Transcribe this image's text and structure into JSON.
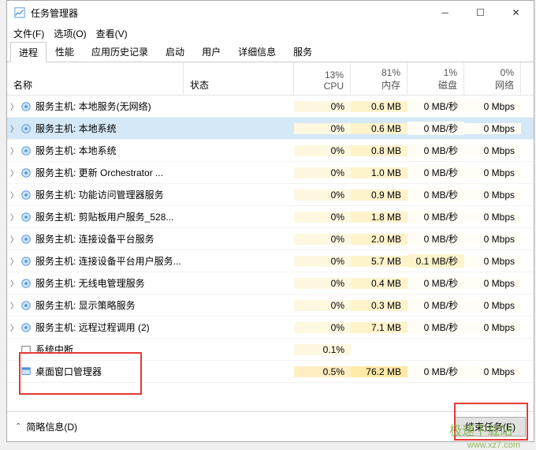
{
  "titlebar": {
    "title": "任务管理器"
  },
  "menu": {
    "file": "文件(F)",
    "options": "选项(O)",
    "view": "查看(V)"
  },
  "tabs": [
    "进程",
    "性能",
    "应用历史记录",
    "启动",
    "用户",
    "详细信息",
    "服务"
  ],
  "columns": {
    "name": "名称",
    "status": "状态",
    "cpu": {
      "pct": "13%",
      "label": "CPU"
    },
    "mem": {
      "pct": "81%",
      "label": "内存"
    },
    "disk": {
      "pct": "1%",
      "label": "磁盘"
    },
    "net": {
      "pct": "0%",
      "label": "网络"
    }
  },
  "rows": [
    {
      "expand": true,
      "icon": "gear",
      "name": "服务主机: 本地服务(无网络)",
      "cpu": "0%",
      "mem": "0.6 MB",
      "disk": "0 MB/秒",
      "net": "0 Mbps",
      "selected": false
    },
    {
      "expand": true,
      "icon": "gear",
      "name": "服务主机: 本地系统",
      "cpu": "0%",
      "mem": "0.6 MB",
      "disk": "0 MB/秒",
      "net": "0 Mbps",
      "selected": true
    },
    {
      "expand": true,
      "icon": "gear",
      "name": "服务主机: 本地系统",
      "cpu": "0%",
      "mem": "0.8 MB",
      "disk": "0 MB/秒",
      "net": "0 Mbps",
      "selected": false
    },
    {
      "expand": true,
      "icon": "gear",
      "name": "服务主机: 更新 Orchestrator ...",
      "cpu": "0%",
      "mem": "1.0 MB",
      "disk": "0 MB/秒",
      "net": "0 Mbps",
      "selected": false
    },
    {
      "expand": true,
      "icon": "gear",
      "name": "服务主机: 功能访问管理器服务",
      "cpu": "0%",
      "mem": "0.9 MB",
      "disk": "0 MB/秒",
      "net": "0 Mbps",
      "selected": false
    },
    {
      "expand": true,
      "icon": "gear",
      "name": "服务主机: 剪贴板用户服务_528...",
      "cpu": "0%",
      "mem": "1.8 MB",
      "disk": "0 MB/秒",
      "net": "0 Mbps",
      "selected": false
    },
    {
      "expand": true,
      "icon": "gear",
      "name": "服务主机: 连接设备平台服务",
      "cpu": "0%",
      "mem": "2.0 MB",
      "disk": "0 MB/秒",
      "net": "0 Mbps",
      "selected": false
    },
    {
      "expand": true,
      "icon": "gear",
      "name": "服务主机: 连接设备平台用户服务...",
      "cpu": "0%",
      "mem": "5.7 MB",
      "disk": "0.1 MB/秒",
      "diskhot": true,
      "net": "0 Mbps",
      "selected": false
    },
    {
      "expand": true,
      "icon": "gear",
      "name": "服务主机: 无线电管理服务",
      "cpu": "0%",
      "mem": "0.4 MB",
      "disk": "0 MB/秒",
      "net": "0 Mbps",
      "selected": false
    },
    {
      "expand": true,
      "icon": "gear",
      "name": "服务主机: 显示策略服务",
      "cpu": "0%",
      "mem": "0.3 MB",
      "disk": "0 MB/秒",
      "net": "0 Mbps",
      "selected": false
    },
    {
      "expand": true,
      "icon": "gear",
      "name": "服务主机: 远程过程调用 (2)",
      "cpu": "0%",
      "mem": "7.1 MB",
      "disk": "0 MB/秒",
      "net": "0 Mbps",
      "selected": false
    },
    {
      "expand": false,
      "icon": "sys",
      "name": "系统中断",
      "cpu": "0.1%",
      "mem": "",
      "disk": "",
      "net": "",
      "selected": false
    },
    {
      "expand": false,
      "icon": "dwm",
      "name": "桌面窗口管理器",
      "cpu": "0.5%",
      "cpuhot": true,
      "mem": "76.2 MB",
      "memhot": true,
      "disk": "0 MB/秒",
      "net": "0 Mbps",
      "selected": false
    }
  ],
  "footer": {
    "less": "简略信息(D)",
    "endtask": "结束任务(E)"
  },
  "watermark": {
    "text": "极速下载站",
    "url": "www.xz7.com"
  }
}
